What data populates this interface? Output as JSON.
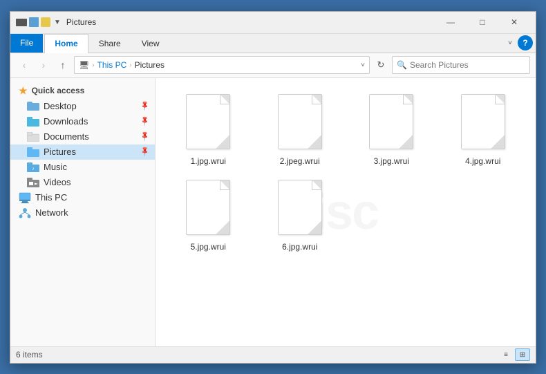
{
  "window": {
    "title": "Pictures",
    "titlebar_icon": "folder",
    "controls": {
      "minimize": "—",
      "maximize": "□",
      "close": "✕"
    }
  },
  "ribbon": {
    "file_tab": "File",
    "tabs": [
      "Home",
      "Share",
      "View"
    ],
    "active_tab": "Home",
    "help_label": "?"
  },
  "address_bar": {
    "back": "‹",
    "forward": "›",
    "up": "↑",
    "breadcrumb": [
      "This PC",
      "Pictures"
    ],
    "dropdown": "˅",
    "refresh": "↻",
    "search_placeholder": "Search Pictures"
  },
  "sidebar": {
    "sections": [
      {
        "type": "header",
        "label": "Quick access",
        "icon": "star"
      },
      {
        "type": "item",
        "label": "Desktop",
        "icon": "folder-blue",
        "pinned": true
      },
      {
        "type": "item",
        "label": "Downloads",
        "icon": "folder-download",
        "pinned": true
      },
      {
        "type": "item",
        "label": "Documents",
        "icon": "folder-documents",
        "pinned": true
      },
      {
        "type": "item",
        "label": "Pictures",
        "icon": "folder-pictures",
        "pinned": true,
        "active": true
      },
      {
        "type": "item",
        "label": "Music",
        "icon": "folder-music"
      },
      {
        "type": "item",
        "label": "Videos",
        "icon": "folder-videos"
      },
      {
        "type": "item",
        "label": "This PC",
        "icon": "computer"
      },
      {
        "type": "item",
        "label": "Network",
        "icon": "network"
      }
    ]
  },
  "content": {
    "files": [
      {
        "name": "1.jpg.wrui",
        "selected": false
      },
      {
        "name": "2.jpeg.wrui",
        "selected": false
      },
      {
        "name": "3.jpg.wrui",
        "selected": false
      },
      {
        "name": "4.jpg.wrui",
        "selected": false
      },
      {
        "name": "5.jpg.wrui",
        "selected": false
      },
      {
        "name": "6.jpg.wrui",
        "selected": false
      }
    ],
    "watermark": "isc"
  },
  "status_bar": {
    "item_count": "6 items",
    "view_list": "≡",
    "view_grid": "⊞"
  }
}
